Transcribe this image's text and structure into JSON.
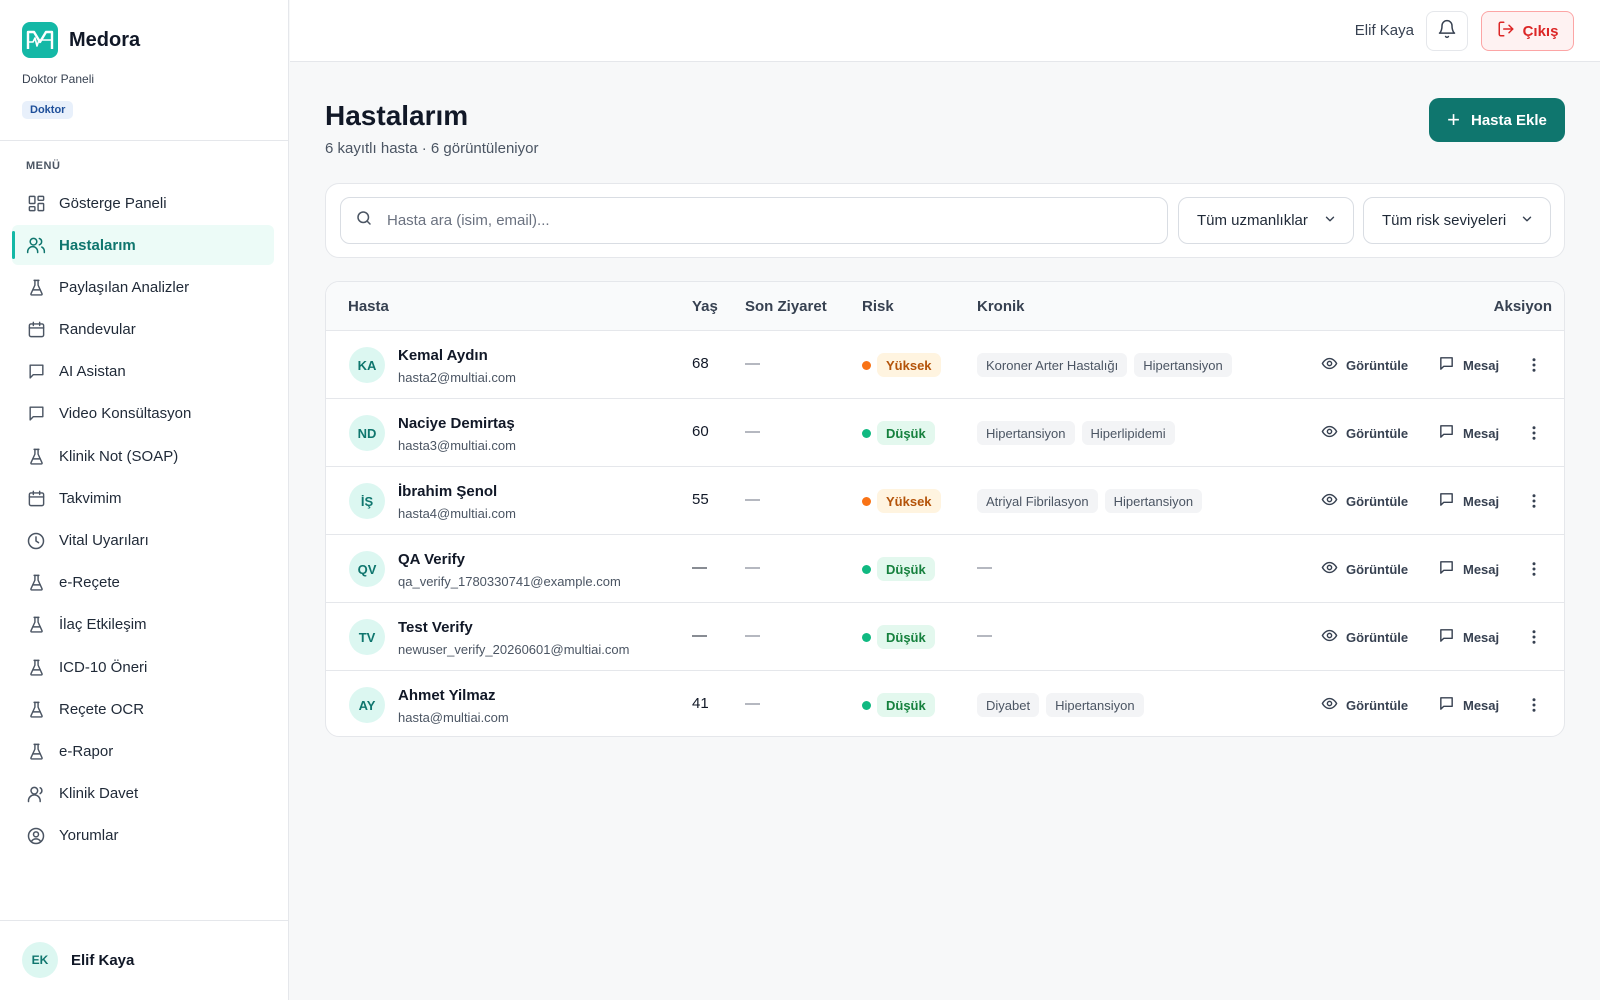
{
  "brand": {
    "name": "Medora",
    "subtitle": "Doktor Paneli",
    "role": "Doktor"
  },
  "sidebar": {
    "menu_title": "MENÜ",
    "items": [
      {
        "label": "Gösterge Paneli",
        "icon": "dashboard-grid-icon"
      },
      {
        "label": "Hastalarım",
        "icon": "users-icon",
        "active": true
      },
      {
        "label": "Paylaşılan Analizler",
        "icon": "flask-icon"
      },
      {
        "label": "Randevular",
        "icon": "calendar-icon"
      },
      {
        "label": "AI Asistan",
        "icon": "chat-icon"
      },
      {
        "label": "Video Konsültasyon",
        "icon": "chat-icon"
      },
      {
        "label": "Klinik Not (SOAP)",
        "icon": "flask-icon"
      },
      {
        "label": "Takvimim",
        "icon": "calendar-icon"
      },
      {
        "label": "Vital Uyarıları",
        "icon": "clock-icon"
      },
      {
        "label": "e-Reçete",
        "icon": "flask-icon"
      },
      {
        "label": "İlaç Etkileşim",
        "icon": "flask-icon"
      },
      {
        "label": "ICD-10 Öneri",
        "icon": "flask-icon"
      },
      {
        "label": "Reçete OCR",
        "icon": "flask-icon"
      },
      {
        "label": "e-Rapor",
        "icon": "flask-icon"
      },
      {
        "label": "Klinik Davet",
        "icon": "user-icon"
      },
      {
        "label": "Yorumlar",
        "icon": "user-circle-icon"
      }
    ],
    "footer_user": {
      "initials": "EK",
      "name": "Elif Kaya"
    }
  },
  "topbar": {
    "user_name": "Elif Kaya",
    "logout_label": "Çıkış"
  },
  "main": {
    "title": "Hastalarım",
    "subtitle": "6 kayıtlı hasta · 6 görüntüleniyor",
    "add_label": "Hasta Ekle",
    "search_placeholder": "Hasta ara (isim, email)...",
    "specialty_filter": "Tüm uzmanlıklar",
    "risk_filter": "Tüm risk seviyeleri"
  },
  "table": {
    "columns": [
      "Hasta",
      "Yaş",
      "Son Ziyaret",
      "Risk",
      "Kronik",
      "Aksiyon"
    ],
    "view_label": "Görüntüle",
    "message_label": "Mesaj",
    "rows": [
      {
        "initials": "KA",
        "name": "Kemal Aydın",
        "email": "hasta2@multiai.com",
        "age": "68",
        "last_visit": "—",
        "risk": "Yüksek",
        "risk_level": "high",
        "chronic": [
          "Koroner Arter Hastalığı",
          "Hipertansiyon"
        ]
      },
      {
        "initials": "ND",
        "name": "Naciye Demirtaş",
        "email": "hasta3@multiai.com",
        "age": "60",
        "last_visit": "—",
        "risk": "Düşük",
        "risk_level": "low",
        "chronic": [
          "Hipertansiyon",
          "Hiperlipidemi"
        ]
      },
      {
        "initials": "İŞ",
        "name": "İbrahim Şenol",
        "email": "hasta4@multiai.com",
        "age": "55",
        "last_visit": "—",
        "risk": "Yüksek",
        "risk_level": "high",
        "chronic": [
          "Atriyal Fibrilasyon",
          "Hipertansiyon"
        ]
      },
      {
        "initials": "QV",
        "name": "QA Verify",
        "email": "qa_verify_1780330741@example.com",
        "age": "—",
        "last_visit": "—",
        "risk": "Düşük",
        "risk_level": "low",
        "chronic": [],
        "chronic_empty": "—"
      },
      {
        "initials": "TV",
        "name": "Test Verify",
        "email": "newuser_verify_20260601@multiai.com",
        "age": "—",
        "last_visit": "—",
        "risk": "Düşük",
        "risk_level": "low",
        "chronic": [],
        "chronic_empty": "—"
      },
      {
        "initials": "AY",
        "name": "Ahmet Yilmaz",
        "email": "hasta@multiai.com",
        "age": "41",
        "last_visit": "—",
        "risk": "Düşük",
        "risk_level": "low",
        "chronic": [
          "Diyabet",
          "Hipertansiyon"
        ]
      }
    ]
  },
  "colors": {
    "accent": "#0f766e",
    "accent_light": "#14b8a6",
    "risk_high": "#f97316",
    "risk_low": "#10b981",
    "danger": "#dc2626"
  }
}
